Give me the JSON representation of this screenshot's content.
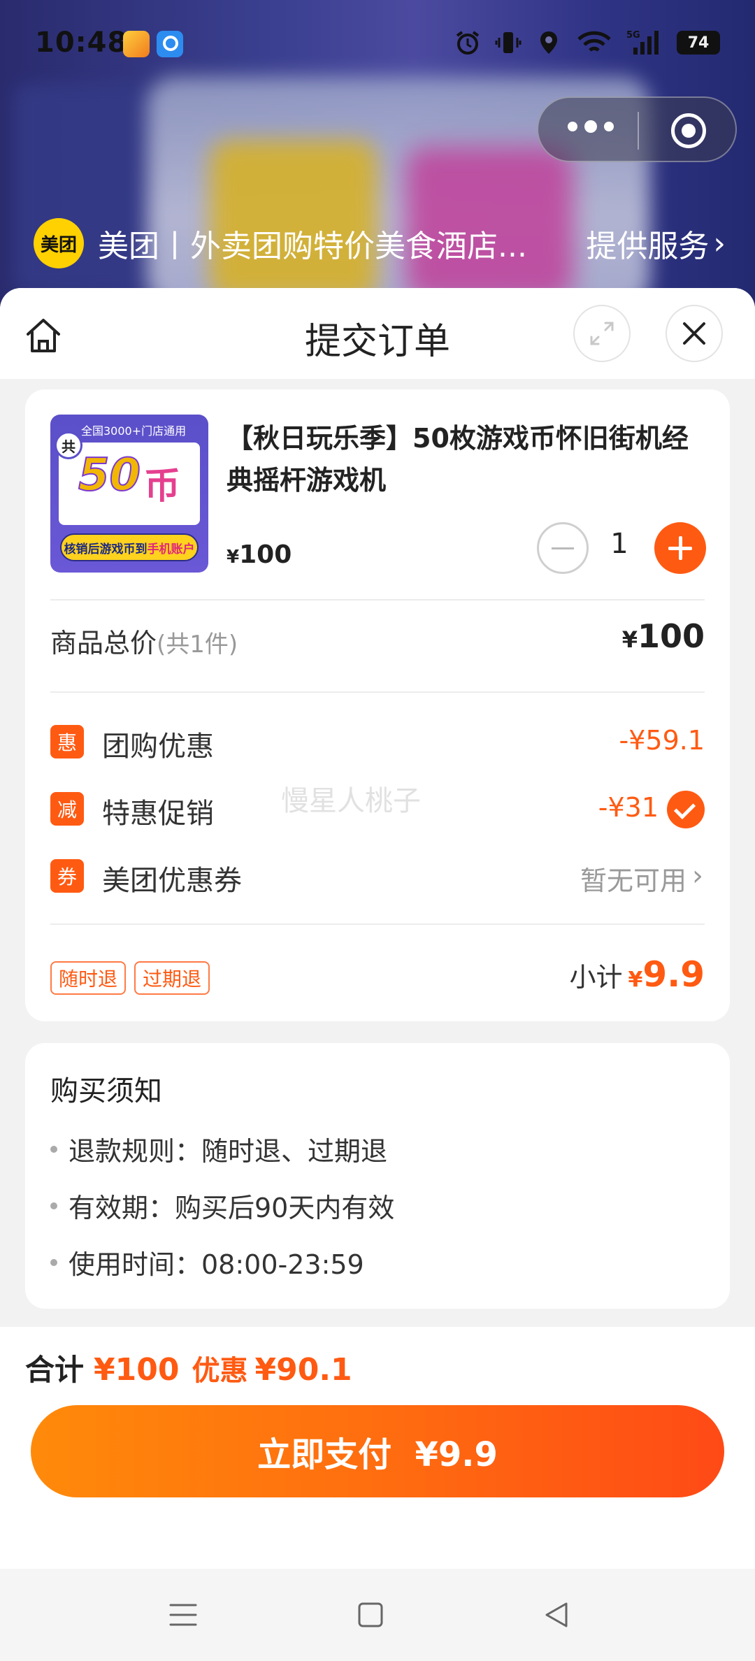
{
  "status_bar": {
    "time": "10:48",
    "icons": [
      "app-618-icon",
      "app-qq-browser-icon",
      "alarm-icon",
      "vibrate-icon",
      "location-icon",
      "wifi-icon",
      "signal-5g-icon"
    ],
    "battery": "74"
  },
  "miniapp": {
    "provider_logo": "美团",
    "provider_name": "美团丨外卖团购特价美食酒店...",
    "service_label": "提供服务"
  },
  "sheet": {
    "title": "提交订单"
  },
  "product": {
    "image": {
      "top_text": "全国3000+门店通用",
      "badge": "共",
      "big_number": "50",
      "big_char": "币",
      "bottom_text_a": "核销后游戏币到",
      "bottom_text_b": "手机账户"
    },
    "title": "【秋日玩乐季】50枚游戏币怀旧街机经典摇杆游戏机",
    "price_currency": "¥",
    "price": "100",
    "quantity": "1"
  },
  "summary": {
    "total_label": "商品总价",
    "total_count": "(共1件)",
    "total_currency": "¥",
    "total_value": "100"
  },
  "discounts": [
    {
      "badge": "惠",
      "label": "团购优惠",
      "value": "-¥59.1"
    },
    {
      "badge": "减",
      "label": "特惠促销",
      "value": "-¥31",
      "checked": true
    },
    {
      "badge": "券",
      "label": "美团优惠券",
      "value": "暂无可用"
    }
  ],
  "watermark": "慢星人桃子",
  "tags": [
    "随时退",
    "过期退"
  ],
  "subtotal": {
    "label": "小计",
    "currency": "¥",
    "value": "9.9"
  },
  "notice": {
    "title": "购买须知",
    "items": [
      "退款规则：随时退、过期退",
      "有效期：购买后90天内有效",
      "使用时间：08:00-23:59"
    ]
  },
  "footer": {
    "sum_label": "合计",
    "sum_total": "¥100",
    "discount_label": "优惠",
    "discount_value": "¥90.1",
    "pay_button": "立即支付  ¥9.9"
  },
  "colors": {
    "accent": "#ff5a12",
    "button_gradient_start": "#ff8a0a",
    "button_gradient_end": "#ff4a16",
    "provider_logo_bg": "#ffd100"
  }
}
